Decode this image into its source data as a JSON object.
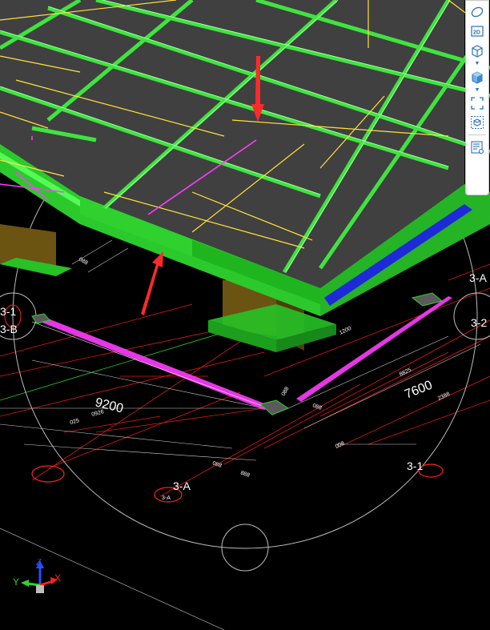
{
  "dimensions": {
    "span_left": "9200",
    "span_right": "7600"
  },
  "grid_labels": {
    "a_bottom": "3-A",
    "one_right": "3-1",
    "one_left": "3-1",
    "b_left": "3-B",
    "two_right": "3-2",
    "a_right": "3-A"
  },
  "small_labels": {
    "s1": "088",
    "s2": "1200",
    "s3": "888",
    "s4": "088",
    "s5": "088",
    "s6": "025",
    "s7": "0926",
    "s8": "8825",
    "s9": "2388",
    "s10": "008",
    "s11": "088",
    "s12": "3-A"
  },
  "toolbar": {
    "items": [
      {
        "name": "orbit-icon"
      },
      {
        "name": "view-2d-icon",
        "label": "2D"
      },
      {
        "name": "view-3d-wireframe-icon"
      },
      {
        "name": "view-3d-shaded-icon"
      },
      {
        "name": "fit-extents-icon"
      },
      {
        "name": "section-box-icon"
      },
      {
        "name": "properties-panel-icon"
      }
    ]
  },
  "axis_gizmo": {
    "x_label": "X",
    "y_label": "Y",
    "z_label": "Z"
  },
  "colors": {
    "slab_top": "#404040",
    "slab_edge": "#2fd12f",
    "beam_line": "#5aff5a",
    "yellow_line": "#ffe23a",
    "magenta_line": "#ff3cff",
    "column": "#6b5312",
    "red_line": "#ff2020",
    "blue_edge": "#1e2ad8",
    "annotation_arrow": "#ff2a2a"
  }
}
